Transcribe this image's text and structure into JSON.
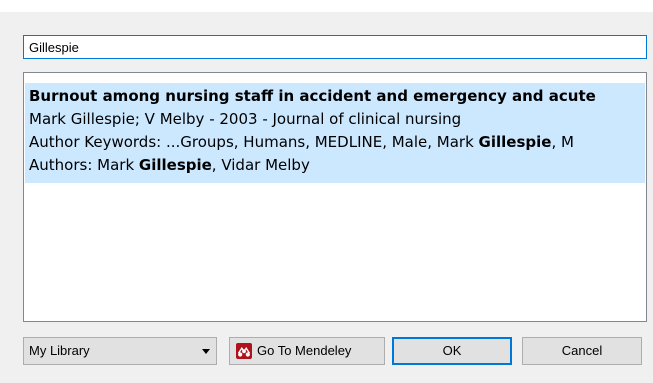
{
  "search": {
    "value": "Gillespie"
  },
  "results": [
    {
      "title": "Burnout among nursing staff in accident and emergency and acute",
      "meta": "Mark Gillespie; V Melby - 2003 - Journal of clinical nursing",
      "keywords_prefix": "Author Keywords: ...Groups, Humans, MEDLINE, Male, Mark ",
      "keywords_highlight": "Gillespie",
      "keywords_suffix": ", M",
      "authors_prefix": "Authors: Mark ",
      "authors_highlight": "Gillespie",
      "authors_suffix": ", Vidar Melby"
    }
  ],
  "footer": {
    "library_value": "My Library",
    "mendeley_label": "Go To Mendeley",
    "ok_label": "OK",
    "cancel_label": "Cancel"
  },
  "colors": {
    "selection": "#cce8ff",
    "focus_border": "#0078d7",
    "mendeley_brand": "#b0121b"
  },
  "icons": {
    "mendeley": "mendeley-logo-icon",
    "dropdown": "chevron-down-icon"
  }
}
